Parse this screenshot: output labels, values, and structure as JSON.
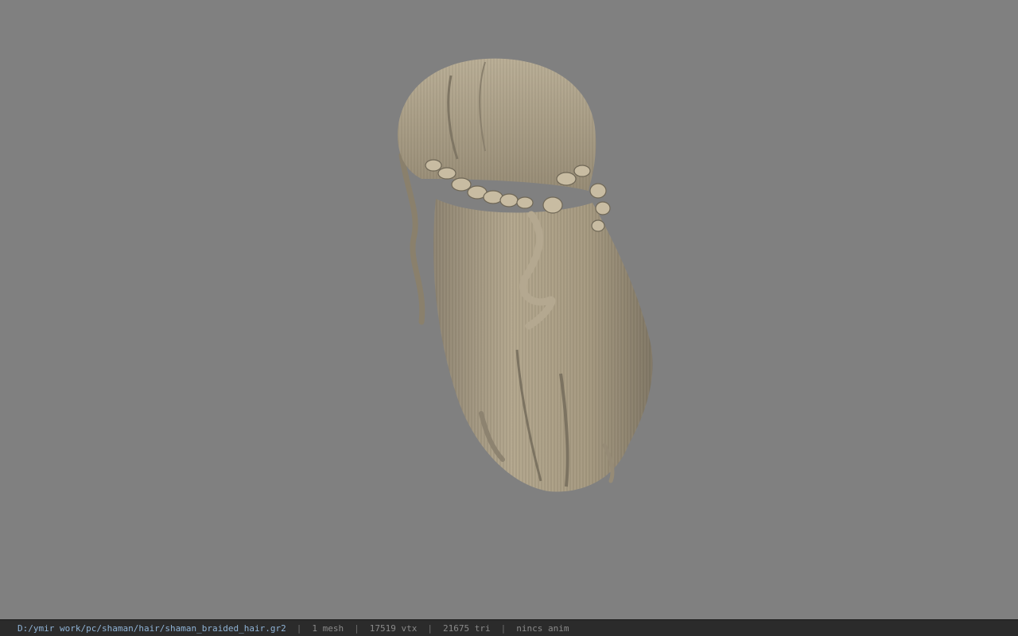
{
  "viewer": {
    "background_color": "#808080",
    "model_color": "#a89c84",
    "model_icon": "braided-hair-mesh"
  },
  "status": {
    "file_path": "D:/ymir work/pc/shaman/hair/shaman_braided_hair.gr2",
    "mesh_count": "1 mesh",
    "vertex_count": "17519 vtx",
    "triangle_count": "21675 tri",
    "anim": "nincs anim",
    "separator": "|"
  }
}
